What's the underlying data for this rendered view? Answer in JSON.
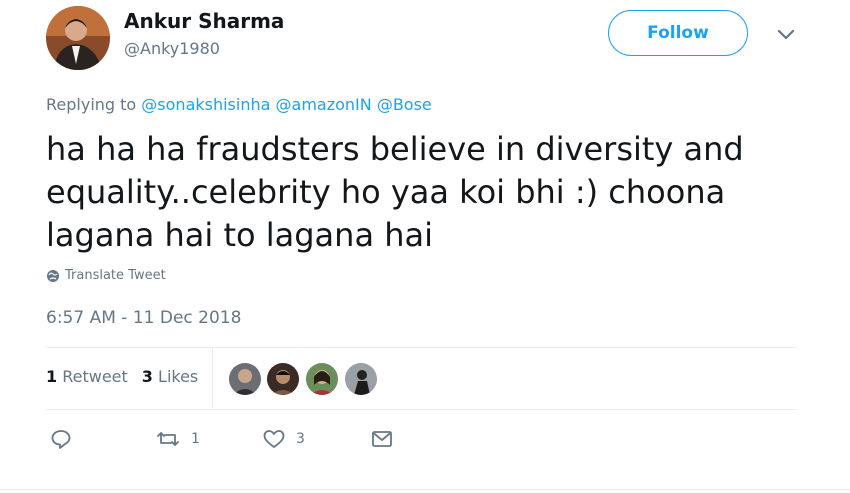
{
  "author": {
    "name": "Ankur Sharma",
    "handle": "@Anky1980"
  },
  "follow_label": "Follow",
  "replying": {
    "prefix": "Replying to",
    "mentions": [
      "@sonakshisinha",
      "@amazonIN",
      "@Bose"
    ]
  },
  "tweet_text": "ha ha ha fraudsters believe in diversity and equality..celebrity ho yaa koi bhi :) choona lagana hai to lagana hai",
  "translate_label": "Translate Tweet",
  "timestamp": "6:57 AM - 11 Dec 2018",
  "stats": {
    "retweets_count": "1",
    "retweets_label": "Retweet",
    "likes_count": "3",
    "likes_label": "Likes"
  },
  "actions": {
    "retweet_count": "1",
    "like_count": "3"
  },
  "colors": {
    "accent": "#1da1f2",
    "secondary_text": "#657786",
    "divider": "#e6ecf0"
  }
}
